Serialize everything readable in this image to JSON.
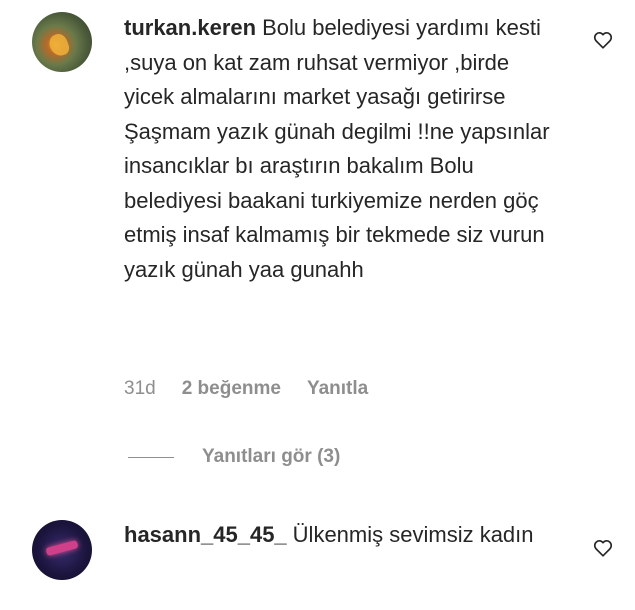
{
  "comments": [
    {
      "username": "turkan.keren",
      "text": "Bolu belediyesi yardımı kesti ,suya on kat zam ruhsat vermiyor ,birde yicek almalarını market yasağı getirirse Şaşmam yazık günah degilmi !!ne yapsınlar insancıklar bı araştırın bakalım Bolu belediyesi baakani turkiyemize nerden göç etmiş insaf kalmamış bir tekmede siz vurun yazık günah yaa gunahh",
      "age": "31d",
      "likes": "2 beğenme",
      "reply": "Yanıtla",
      "view_replies": "Yanıtları gör (3)",
      "heart_icon": "heart-outline-icon"
    },
    {
      "username": "hasann_45_45_",
      "text": "Ülkenmiş sevimsiz kadın",
      "heart_icon": "heart-outline-icon"
    }
  ],
  "colors": {
    "text": "#262626",
    "secondary": "#8e8e8e",
    "background": "#ffffff"
  }
}
